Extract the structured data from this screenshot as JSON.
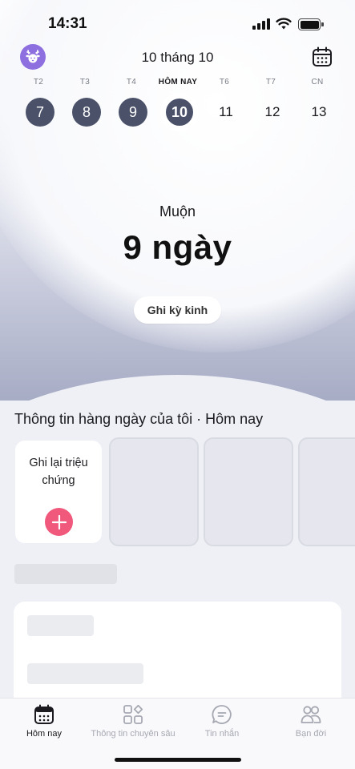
{
  "status_bar": {
    "time": "14:31"
  },
  "header": {
    "date_title": "10 tháng 10"
  },
  "week": {
    "labels": [
      "T2",
      "T3",
      "T4",
      "HÔM NAY",
      "T6",
      "T7",
      "CN"
    ],
    "days": [
      "7",
      "8",
      "9",
      "10",
      "11",
      "12",
      "13"
    ]
  },
  "status": {
    "label": "Muộn",
    "value": "9 ngày",
    "action_label": "Ghi kỳ kinh"
  },
  "daily_info": {
    "title": "Thông tin hàng ngày của tôi · Hôm nay",
    "add_card_label": "Ghi lại triệu chứng"
  },
  "tabs": [
    "Hôm nay",
    "Thông tin chuyên sâu",
    "Tin nhắn",
    "Bạn đời"
  ],
  "colors": {
    "accent_pink": "#f0587c",
    "avatar_purple": "#8d6fe0",
    "day_circle": "#4a5169"
  },
  "icons": {
    "avatar": "deer-icon",
    "calendar": "calendar-icon",
    "add": "plus-icon",
    "tab_today": "calendar-icon",
    "tab_insights": "grid-shapes-icon",
    "tab_messages": "chat-bubble-icon",
    "tab_partner": "people-icon"
  }
}
